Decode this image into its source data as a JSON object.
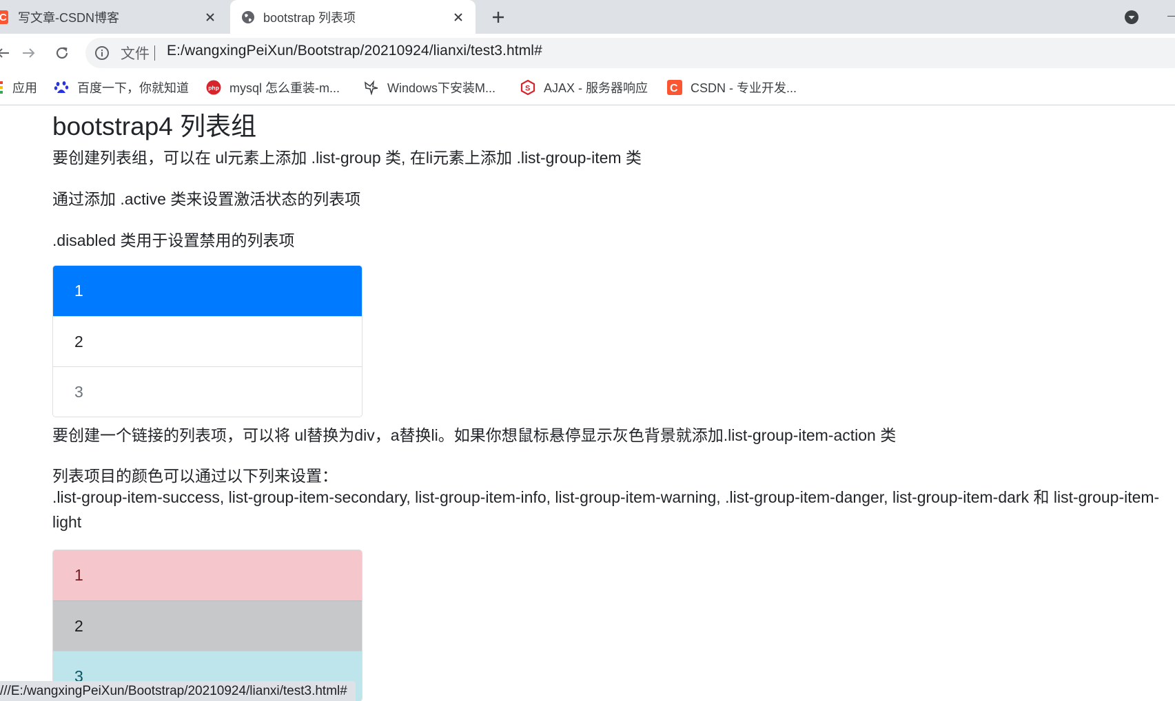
{
  "browser": {
    "tabs": [
      {
        "title": "写文章-CSDN博客",
        "favicon": "csdn-icon"
      },
      {
        "title": "bootstrap 列表项",
        "favicon": "globe-icon"
      }
    ],
    "omnibox": {
      "scheme_label": "文件",
      "url": "E:/wangxingPeiXun/Bootstrap/20210924/lianxi/test3.html#"
    },
    "bookmarks": [
      {
        "label": "应用",
        "icon": "apps-grid-icon"
      },
      {
        "label": "百度一下，你就知道",
        "icon": "baidu-paw-icon"
      },
      {
        "label": "mysql 怎么重装-m...",
        "icon": "php-icon"
      },
      {
        "label": "Windows下安装M...",
        "icon": "bird-icon"
      },
      {
        "label": "AJAX - 服务器响应",
        "icon": "w3school-icon"
      },
      {
        "label": "CSDN - 专业开发...",
        "icon": "csdn-icon"
      }
    ],
    "status_url": "///E:/wangxingPeiXun/Bootstrap/20210924/lianxi/test3.html#"
  },
  "content": {
    "heading": "bootstrap4 列表组",
    "p1": "要创建列表组，可以在 ul元素上添加 .list-group 类, 在li元素上添加 .list-group-item 类",
    "p2": "通过添加 .active 类来设置激活状态的列表项",
    "p3": ".disabled 类用于设置禁用的列表项",
    "list1": [
      {
        "label": "1",
        "state": "active"
      },
      {
        "label": "2",
        "state": "normal"
      },
      {
        "label": "3",
        "state": "disabled"
      }
    ],
    "p4": "要创建一个链接的列表项，可以将 ul替换为div，a替换li。如果你想鼠标悬停显示灰色背景就添加.list-group-item-action 类",
    "p5_line1": "列表项目的颜色可以通过以下列来设置：",
    "p5_line2": ".list-group-item-success, list-group-item-secondary, list-group-item-info, list-group-item-warning, .list-group-item-danger, list-group-item-dark 和 list-group-item-light",
    "list2": [
      {
        "label": "1",
        "variant": "danger"
      },
      {
        "label": "2",
        "variant": "dark"
      },
      {
        "label": "3",
        "variant": "info"
      }
    ]
  },
  "colors": {
    "active_bg": "#007bff",
    "danger_bg": "#f5c6cb",
    "danger_text": "#721c24",
    "dark_bg": "#c6c8ca",
    "dark_text": "#1b1e21",
    "info_bg": "#bee5eb",
    "info_text": "#0c5460",
    "disabled_text": "#6c757d"
  }
}
